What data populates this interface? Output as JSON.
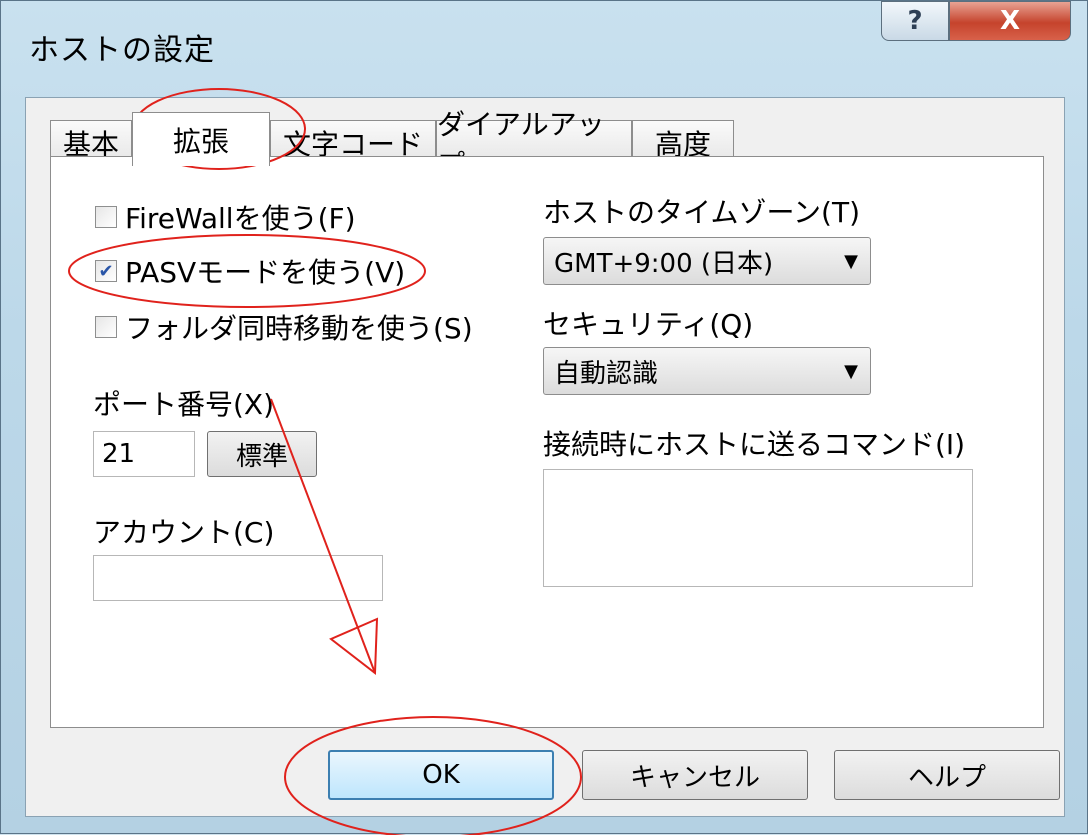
{
  "window": {
    "title": "ホストの設定",
    "help_glyph": "?",
    "close_glyph": "X"
  },
  "tabs": [
    {
      "label": "基本",
      "active": false
    },
    {
      "label": "拡張",
      "active": true
    },
    {
      "label": "文字コード",
      "active": false
    },
    {
      "label": "ダイアルアップ",
      "active": false
    },
    {
      "label": "高度",
      "active": false
    }
  ],
  "options": {
    "firewall": {
      "label": "FireWallを使う(F)",
      "checked": false
    },
    "pasv": {
      "label": "PASVモードを使う(V)",
      "checked": true
    },
    "sync_move": {
      "label": "フォルダ同時移動を使う(S)",
      "checked": false
    }
  },
  "port": {
    "label": "ポート番号(X)",
    "value": "21",
    "default_button": "標準"
  },
  "account": {
    "label": "アカウント(C)",
    "value": ""
  },
  "timezone": {
    "label": "ホストのタイムゾーン(T)",
    "selected": "GMT+9:00 (日本)"
  },
  "security": {
    "label": "セキュリティ(Q)",
    "selected": "自動認識"
  },
  "connect_command": {
    "label": "接続時にホストに送るコマンド(I)",
    "value": ""
  },
  "buttons": {
    "ok": "OK",
    "cancel": "キャンセル",
    "help": "ヘルプ"
  },
  "checkmark_glyph": "✔",
  "dropdown_glyph": "▼",
  "annotation_color": "#e0221c"
}
